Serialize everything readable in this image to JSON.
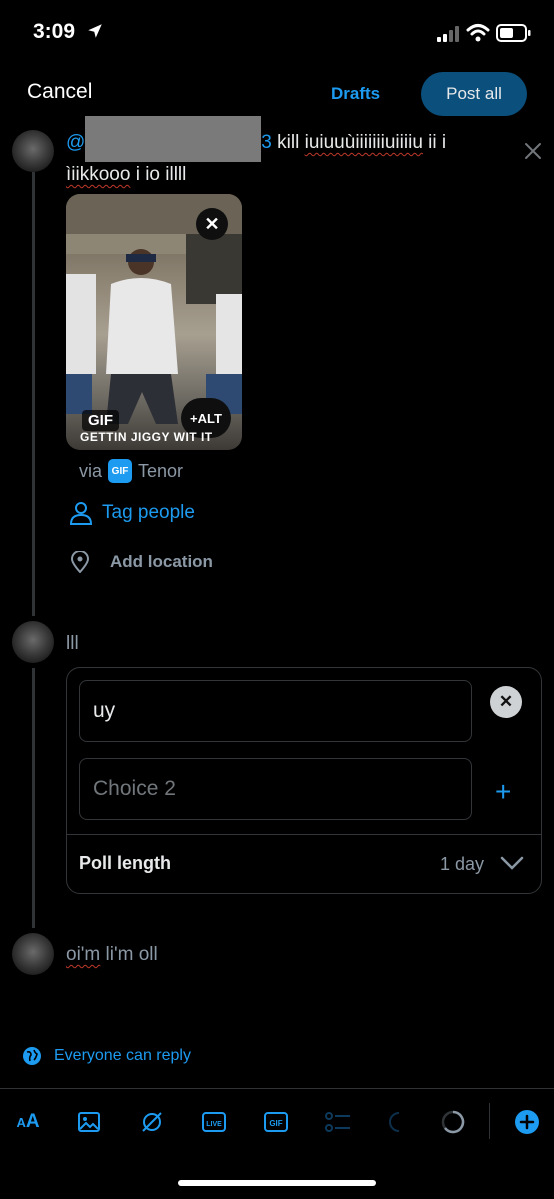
{
  "status_bar": {
    "time": "3:09"
  },
  "header": {
    "cancel_label": "Cancel",
    "drafts_label": "Drafts",
    "post_all_label": "Post all"
  },
  "tweet1": {
    "mention_prefix": "@",
    "mention_suffix": "3",
    "text_line1": " kill ",
    "text_line1_b": "iuiuuùiiiiiiiuiiiiu",
    "text_line1_c": " ii  i",
    "text_line2_a": "ìiikkooo",
    "text_line2_b": " i io  illll",
    "gif_badge": "GIF",
    "alt_badge": "+ALT",
    "gif_caption": "GETTIN JIGGY WIT IT",
    "via_label": "via",
    "via_logo": "GIF",
    "via_source": "Tenor",
    "tag_people_label": "Tag people",
    "add_location_label": "Add location"
  },
  "tweet2": {
    "text": "lll",
    "poll": {
      "choice1_value": "uy",
      "choice2_placeholder": "Choice 2",
      "length_label": "Poll length",
      "length_value": "1 day"
    }
  },
  "tweet3": {
    "text_a": "oi'm",
    "text_b": " li'm oll"
  },
  "reply_setting": {
    "label": "Everyone can reply"
  },
  "toolbar": {
    "icons": [
      "text-size-icon",
      "image-icon",
      "camera-off-icon",
      "live-icon",
      "gif-icon",
      "poll-icon",
      "circle-progress-icon",
      "add-tweet-icon"
    ],
    "text_size_label": "AA",
    "live_label": "LIVE",
    "gif_label": "GIF"
  },
  "colors": {
    "accent": "#1d9bf0",
    "background": "#000000",
    "post_button": "#0b4f7c",
    "muted": "#8b98a5",
    "border": "#333639"
  }
}
